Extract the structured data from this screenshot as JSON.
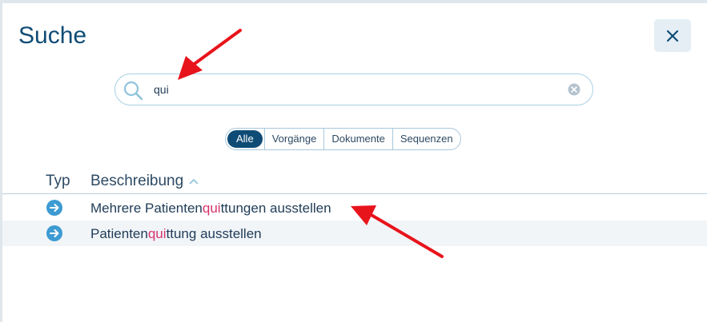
{
  "dialog": {
    "title": "Suche",
    "close_icon": "close-icon"
  },
  "search": {
    "value": "qui",
    "search_icon": "search-icon",
    "clear_icon": "clear-icon"
  },
  "filters": [
    {
      "label": "Alle",
      "active": true
    },
    {
      "label": "Vorgänge",
      "active": false
    },
    {
      "label": "Dokumente",
      "active": false
    },
    {
      "label": "Sequenzen",
      "active": false
    }
  ],
  "table": {
    "columns": {
      "type": "Typ",
      "description": "Beschreibung"
    },
    "sort": "ascending",
    "rows": [
      {
        "icon": "arrow-right-circle-icon",
        "prefix": "Mehrere Patienten",
        "match": "qui",
        "suffix": "ttungen ausstellen"
      },
      {
        "icon": "arrow-right-circle-icon",
        "prefix": "Patienten",
        "match": "qui",
        "suffix": "ttung ausstellen"
      }
    ]
  },
  "colors": {
    "primary": "#0f4c75",
    "highlight": "#d6336c",
    "annotation": "#e8141b"
  }
}
